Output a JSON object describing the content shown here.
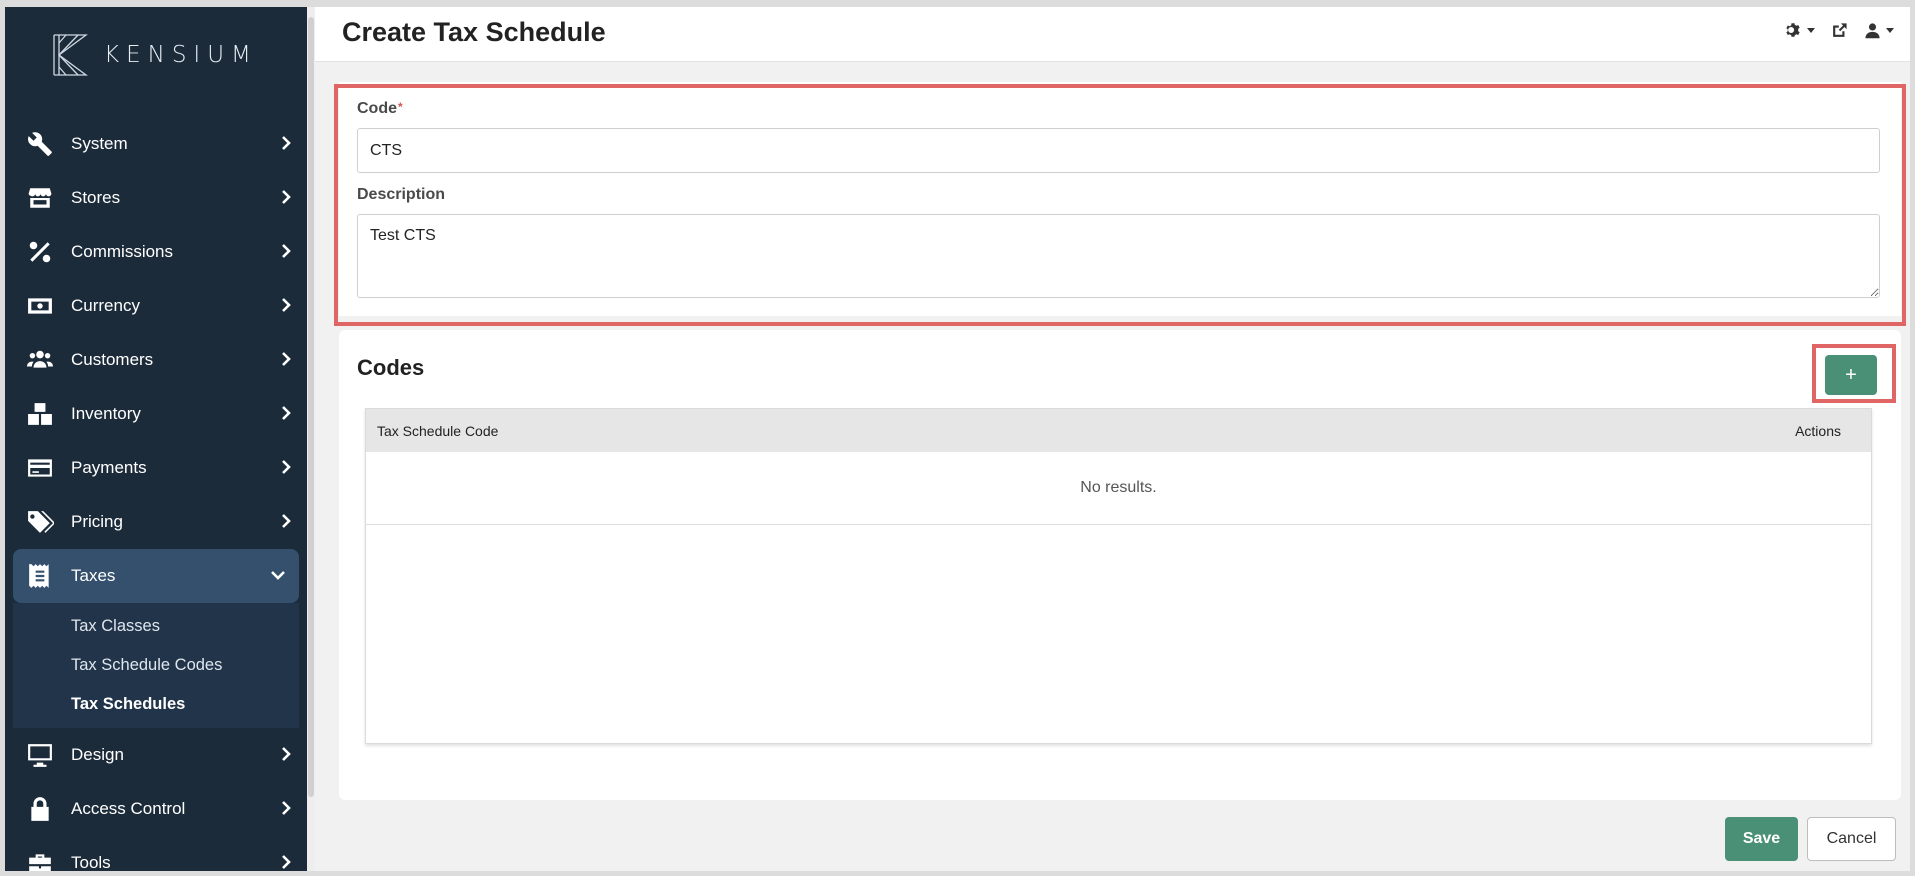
{
  "brand": {
    "name": "KENSIUM"
  },
  "sidebar": {
    "items": [
      {
        "label": "System",
        "icon": "wrench-icon"
      },
      {
        "label": "Stores",
        "icon": "store-icon"
      },
      {
        "label": "Commissions",
        "icon": "percent-icon"
      },
      {
        "label": "Currency",
        "icon": "money-bill-icon"
      },
      {
        "label": "Customers",
        "icon": "users-icon"
      },
      {
        "label": "Inventory",
        "icon": "boxes-icon"
      },
      {
        "label": "Payments",
        "icon": "credit-card-icon"
      },
      {
        "label": "Pricing",
        "icon": "tags-icon"
      },
      {
        "label": "Taxes",
        "icon": "receipt-icon",
        "expanded": true
      },
      {
        "label": "Design",
        "icon": "desktop-icon"
      },
      {
        "label": "Access Control",
        "icon": "lock-icon"
      },
      {
        "label": "Tools",
        "icon": "toolbox-icon"
      }
    ],
    "taxes_sub": [
      {
        "label": "Tax Classes"
      },
      {
        "label": "Tax Schedule Codes"
      },
      {
        "label": "Tax Schedules",
        "current": true
      }
    ]
  },
  "header": {
    "title": "Create Tax Schedule",
    "icons": [
      "gear-icon",
      "external-link-icon",
      "user-icon"
    ]
  },
  "form": {
    "code_label": "Code",
    "code_required": "*",
    "code_value": "CTS",
    "description_label": "Description",
    "description_value": "Test CTS"
  },
  "codes": {
    "title": "Codes",
    "add_label": "+",
    "columns": [
      "Tax Schedule Code",
      "Actions"
    ],
    "rows": [],
    "empty_text": "No results."
  },
  "footer": {
    "save_label": "Save",
    "cancel_label": "Cancel"
  },
  "colors": {
    "sidebar": "#1c2b3a",
    "accent": "#4a9076",
    "highlight": "#e06666"
  }
}
